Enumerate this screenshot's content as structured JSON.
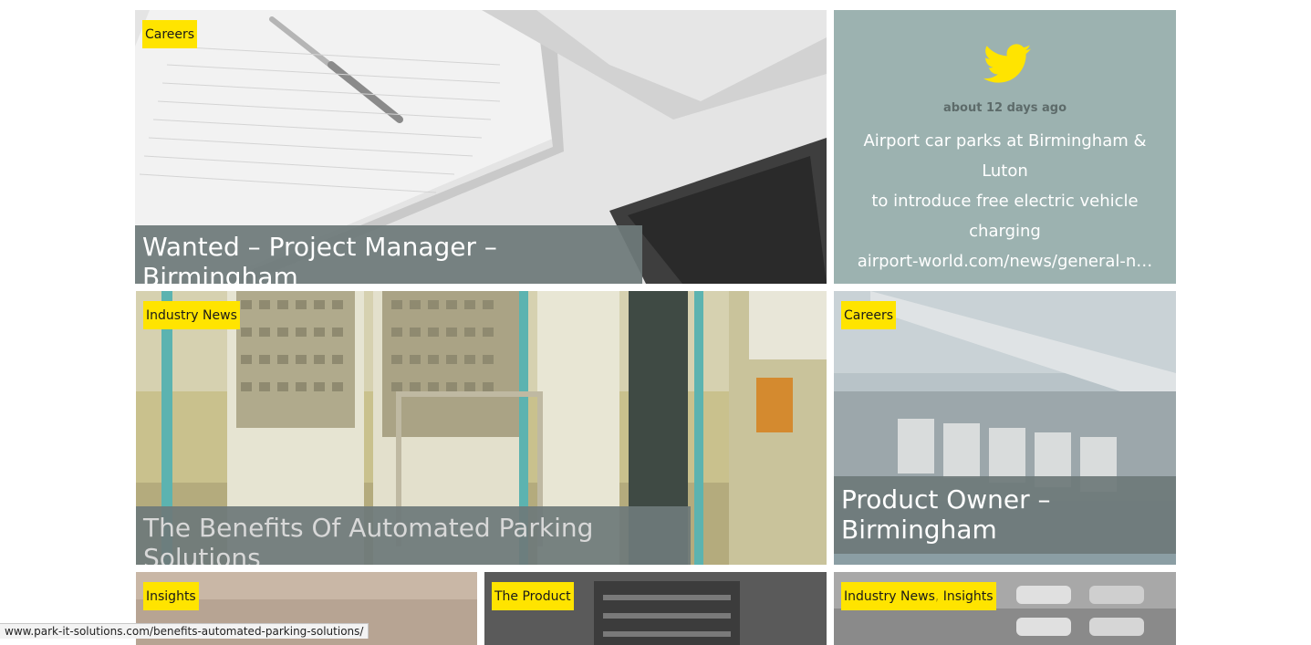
{
  "cards": {
    "project_manager": {
      "tags": [
        "Careers"
      ],
      "title": "Wanted – Project Manager – Birmingham"
    },
    "twitter": {
      "icon": "twitter-icon",
      "time": "about 12 days ago",
      "text_line1": "Airport car parks at Birmingham & Luton",
      "text_line2": "to introduce free electric vehicle charging",
      "link": "airport-world.com/news/general-n…"
    },
    "automated_parking": {
      "tags": [
        "Industry News"
      ],
      "title": "The Benefits Of Automated Parking Solutions"
    },
    "product_owner": {
      "tags": [
        "Careers"
      ],
      "title_line1": "Product Owner –",
      "title_line2": "Birmingham"
    },
    "insights_card": {
      "tags": [
        "Insights"
      ]
    },
    "product_card": {
      "tags": [
        "The Product"
      ]
    },
    "industry_insights": {
      "tags": [
        "Industry News",
        "Insights"
      ],
      "separator": ","
    }
  },
  "status_bar": {
    "url": "www.park-it-solutions.com/benefits-automated-parking-solutions/"
  },
  "colors": {
    "accent_yellow": "#ffe400",
    "twitter_bg": "#9cb2b0",
    "title_overlay": "#6e7a7a"
  }
}
